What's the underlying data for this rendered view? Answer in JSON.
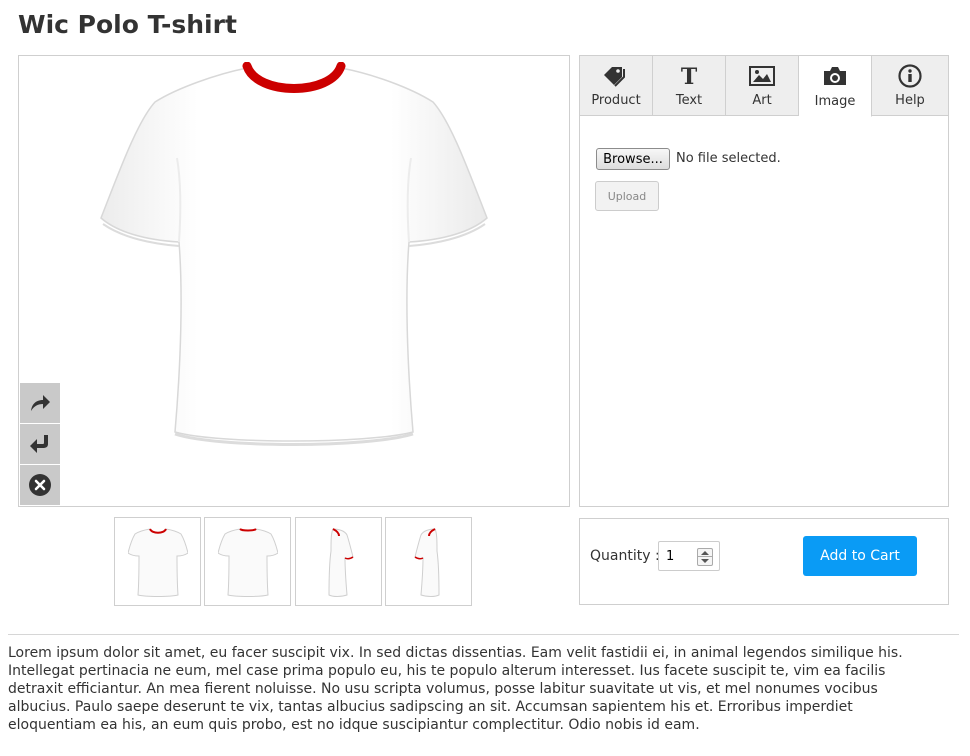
{
  "product": {
    "title": "Wic Polo T-shirt"
  },
  "designer": {
    "tools": [
      {
        "name": "redo",
        "icon": "redo-arrow-icon"
      },
      {
        "name": "undo",
        "icon": "undo-arrow-icon"
      },
      {
        "name": "clear",
        "icon": "close-circle-icon"
      }
    ],
    "shirt": {
      "body_color": "#ffffff",
      "collar_color": "#cc0000"
    }
  },
  "tabs": [
    {
      "label": "Product",
      "icon": "tag-icon",
      "active": false
    },
    {
      "label": "Text",
      "icon": "text-t-icon",
      "active": false
    },
    {
      "label": "Art",
      "icon": "picture-icon",
      "active": false
    },
    {
      "label": "Image",
      "icon": "camera-icon",
      "active": true
    },
    {
      "label": "Help",
      "icon": "info-circle-icon",
      "active": false
    }
  ],
  "image_panel": {
    "browse_label": "Browse...",
    "file_status": "No file selected.",
    "upload_label": "Upload"
  },
  "thumbnails": [
    {
      "view": "front"
    },
    {
      "view": "back"
    },
    {
      "view": "left-side"
    },
    {
      "view": "right-side"
    }
  ],
  "cart": {
    "quantity_label": "Quantity :",
    "quantity_value": "1",
    "add_to_cart_label": "Add to Cart",
    "button_color": "#0a9bf5"
  },
  "description": "Lorem ipsum dolor sit amet, eu facer suscipit vix. In sed dictas dissentias. Eam velit fastidii ei, in animal legendos similique his. Intellegat pertinacia ne eum, mel case prima populo eu, his te populo alterum interesset. Ius facete suscipit te, vim ea facilis detraxit efficiantur. An mea fierent noluisse. No usu scripta volumus, posse labitur suavitate ut vis, et mel nonumes vocibus albucius. Paulo saepe deserunt te vix, tantas albucius sadipscing an sit. Accumsan sapientem his et. Erroribus imperdiet eloquentiam ea his, an eum quis probo, est no idque suscipiantur complectitur. Odio nobis id eam."
}
